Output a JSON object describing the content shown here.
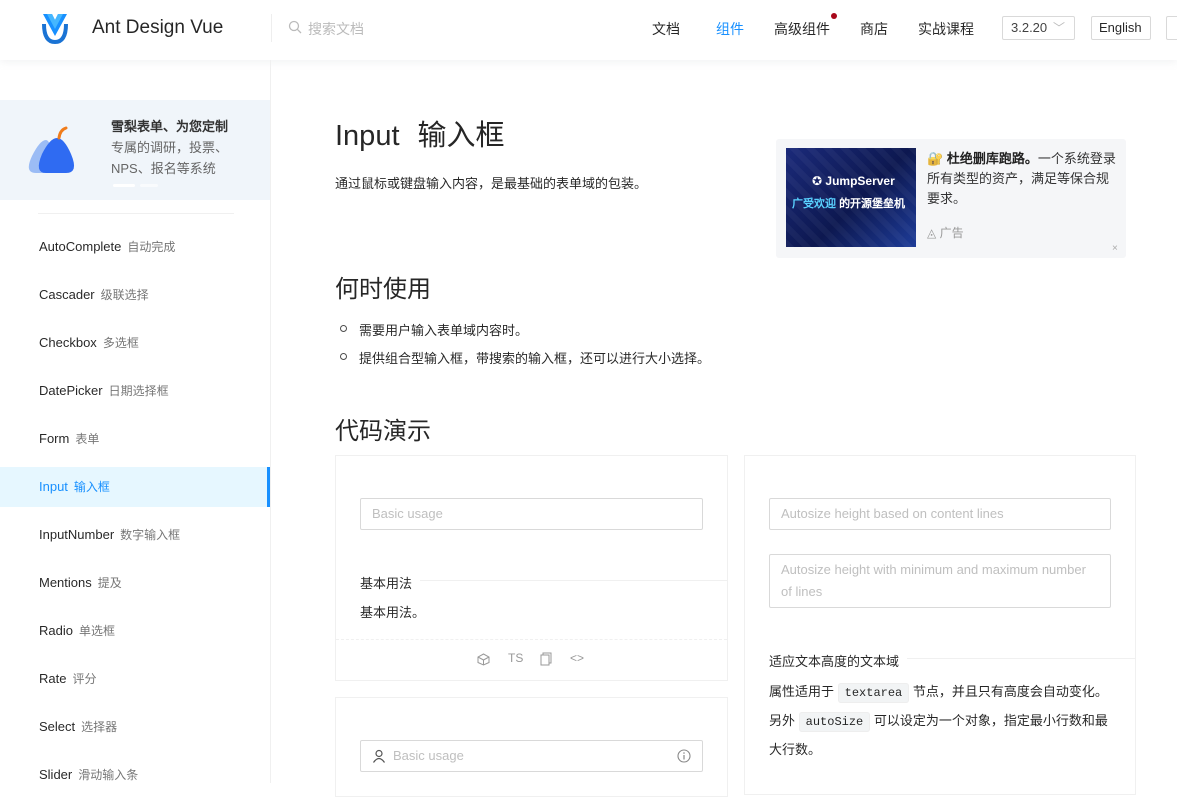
{
  "header": {
    "brand": "Ant Design Vue",
    "search_placeholder": "搜索文档",
    "nav": [
      "文档",
      "组件",
      "高级组件",
      "商店",
      "实战课程"
    ],
    "active_nav": "组件",
    "version": "3.2.20",
    "language": "English",
    "accent": "#1890ff"
  },
  "sidebar": {
    "promo": {
      "title": "雪梨表单、为您定制",
      "text": "专属的调研，投票、NPS、报名等系统"
    },
    "items": [
      {
        "en": "AutoComplete",
        "zh": "自动完成"
      },
      {
        "en": "Cascader",
        "zh": "级联选择"
      },
      {
        "en": "Checkbox",
        "zh": "多选框"
      },
      {
        "en": "DatePicker",
        "zh": "日期选择框"
      },
      {
        "en": "Form",
        "zh": "表单"
      },
      {
        "en": "Input",
        "zh": "输入框"
      },
      {
        "en": "InputNumber",
        "zh": "数字输入框"
      },
      {
        "en": "Mentions",
        "zh": "提及"
      },
      {
        "en": "Radio",
        "zh": "单选框"
      },
      {
        "en": "Rate",
        "zh": "评分"
      },
      {
        "en": "Select",
        "zh": "选择器"
      },
      {
        "en": "Slider",
        "zh": "滑动输入条"
      }
    ],
    "selected": "Input"
  },
  "page": {
    "title_en": "Input",
    "title_zh": "输入框",
    "description": "通过鼠标或键盘输入内容，是最基础的表单域的包装。",
    "when_heading": "何时使用",
    "when_items": [
      "需要用户输入表单域内容时。",
      "提供组合型输入框，带搜索的输入框，还可以进行大小选择。"
    ],
    "demo_heading": "代码演示"
  },
  "ad": {
    "image_logo": "JumpServer",
    "image_sub_highlight": "广受欢迎",
    "image_sub": "的开源堡垒机",
    "title": "杜绝删库跑路。",
    "text": "一个系统登录所有类型的资产，满足等保合规要求。",
    "tag": "广告",
    "close": "×"
  },
  "demos": {
    "basic": {
      "placeholder": "Basic usage",
      "title": "基本用法",
      "desc": "基本用法。",
      "actions": [
        "codesandbox",
        "TS",
        "copy",
        "code"
      ],
      "ts_label": "TS"
    },
    "autosize": {
      "placeholder1": "Autosize height based on content lines",
      "placeholder2": "Autosize height with minimum and maximum number of lines",
      "title": "适应文本高度的文本域",
      "desc_a": "属性适用于",
      "code1": "textarea",
      "desc_b": "节点，并且只有高度会自动变化。另外",
      "code2": "autoSize",
      "desc_c": "可以设定为一个对象，指定最小行数和最大行数。"
    },
    "prefix": {
      "placeholder": "Basic usage"
    }
  }
}
